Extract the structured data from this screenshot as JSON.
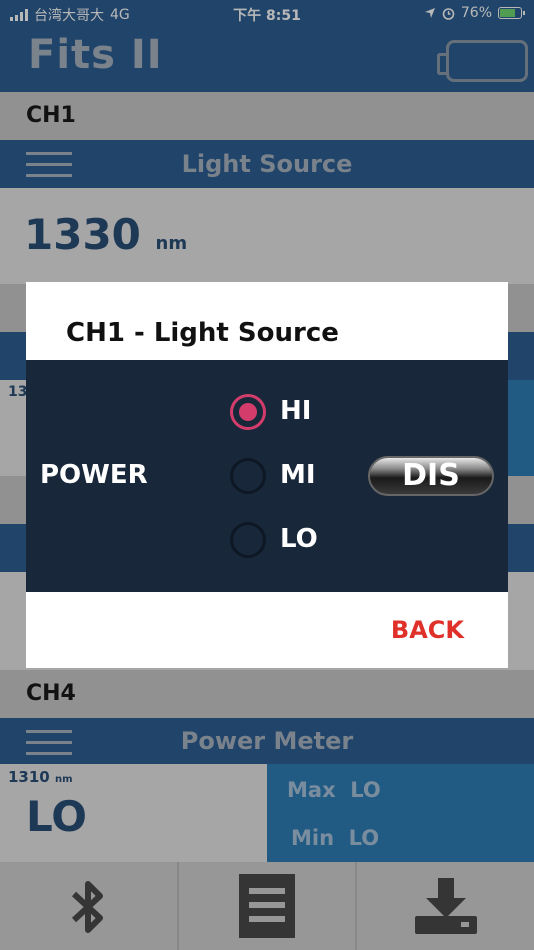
{
  "statusbar": {
    "carrier": "台湾大哥大",
    "network": "4G",
    "time": "下午 8:51",
    "battery_pct": "76%"
  },
  "app": {
    "title": "Fits II"
  },
  "ch1": {
    "label": "CH1",
    "mode": "Light Source",
    "reading": "1330",
    "unit": "nm"
  },
  "ch4": {
    "label": "CH4",
    "mode": "Power Meter",
    "wavelength": "1310",
    "wavelength_unit": "nm",
    "reading": "LO",
    "max_label": "Max",
    "max_value": "LO",
    "min_label": "Min",
    "min_value": "LO"
  },
  "partial": {
    "ch2_reading": "13"
  },
  "dialog": {
    "title": "CH1 - Light Source",
    "power_label": "POWER",
    "options": [
      {
        "label": "HI",
        "selected": true
      },
      {
        "label": "MI",
        "selected": false
      },
      {
        "label": "LO",
        "selected": false
      }
    ],
    "dis_label": "DIS",
    "back_label": "BACK"
  },
  "footer": {
    "icons": [
      "bluetooth-icon",
      "document-icon",
      "download-icon"
    ]
  },
  "colors": {
    "header": "#2d5f93",
    "dialog_body": "#18283a",
    "accent": "#d43d6b",
    "back": "#e0302a"
  }
}
